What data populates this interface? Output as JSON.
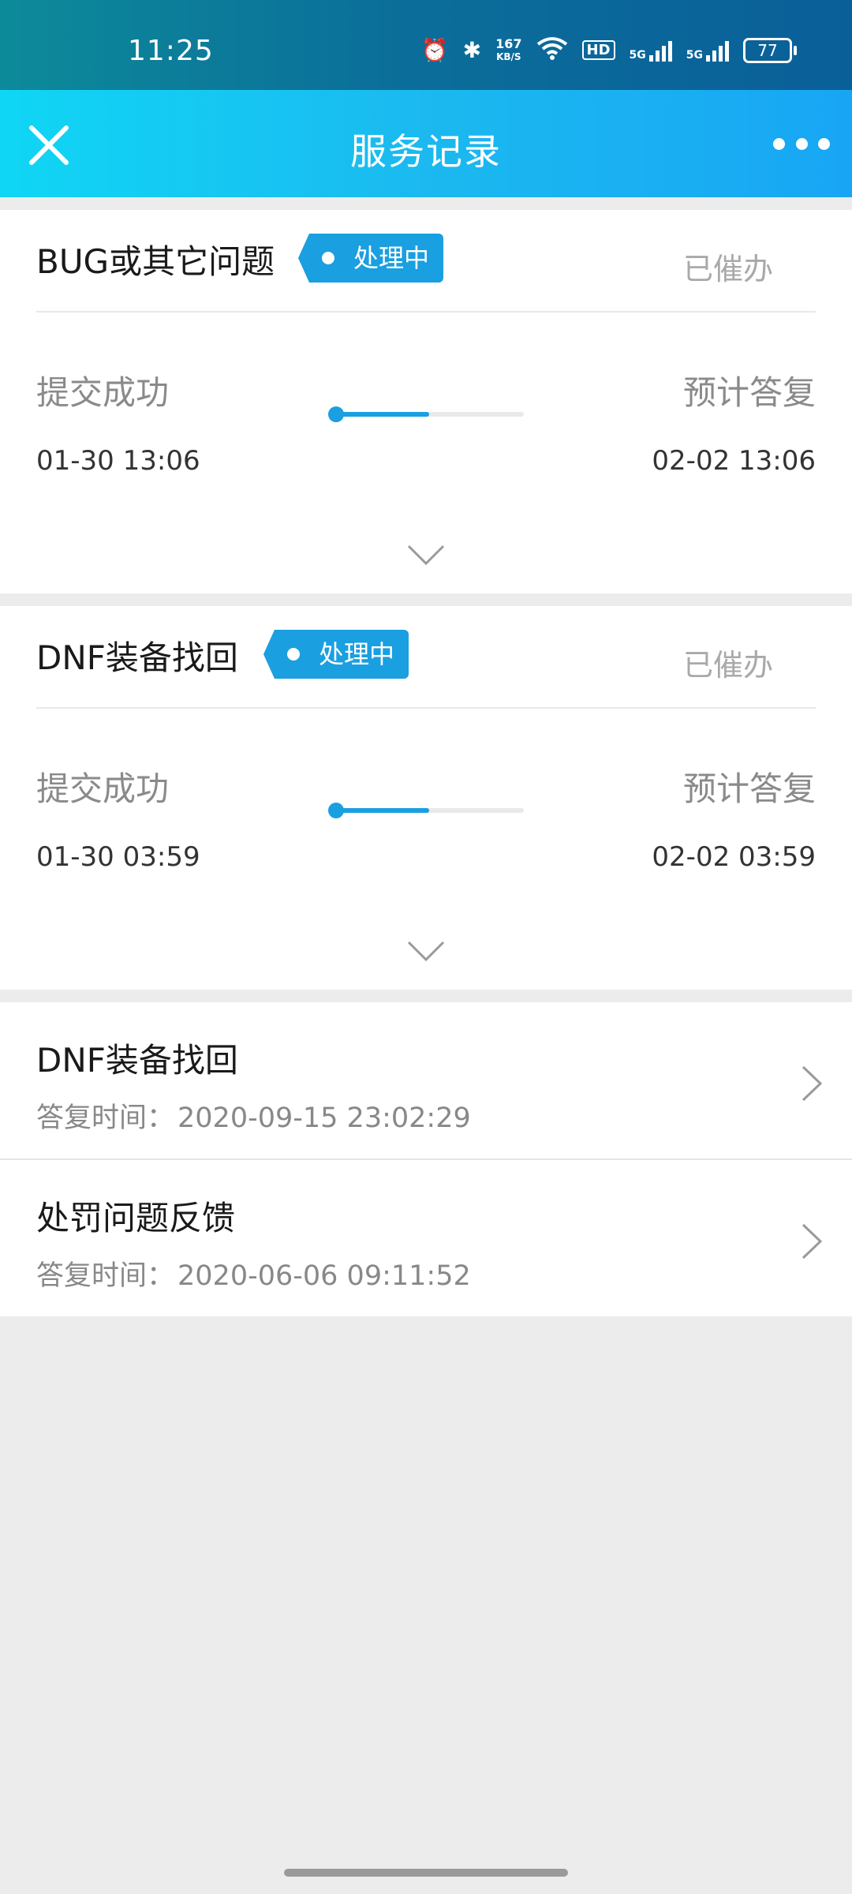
{
  "status_bar": {
    "time": "11:25",
    "net_speed_top": "167",
    "net_speed_bottom": "KB/S",
    "hd_label": "HD",
    "sim1_label": "5G",
    "sim2_label": "5G",
    "battery": "77"
  },
  "header": {
    "title": "服务记录",
    "close_icon": "close-icon",
    "more_icon": "more-icon"
  },
  "active_tickets": [
    {
      "title": "BUG或其它问题",
      "status": "处理中",
      "urge_label": "已催办",
      "start_label": "提交成功",
      "start_date": "01-30 13:06",
      "end_label": "预计答复",
      "end_date": "02-02 13:06",
      "progress": 0.5
    },
    {
      "title": "DNF装备找回",
      "status": "处理中",
      "urge_label": "已催办",
      "start_label": "提交成功",
      "start_date": "01-30 03:59",
      "end_label": "预计答复",
      "end_date": "02-02 03:59",
      "progress": 0.5
    }
  ],
  "history": [
    {
      "title": "DNF装备找回",
      "reply_label": "答复时间：",
      "reply_time": "2020-09-15 23:02:29"
    },
    {
      "title": "处罚问题反馈",
      "reply_label": "答复时间：",
      "reply_time": "2020-06-06 09:11:52"
    }
  ],
  "colors": {
    "accent": "#1a9fe0",
    "header_start": "#10d6f5",
    "header_end": "#18a6f4",
    "background": "#ececec"
  }
}
